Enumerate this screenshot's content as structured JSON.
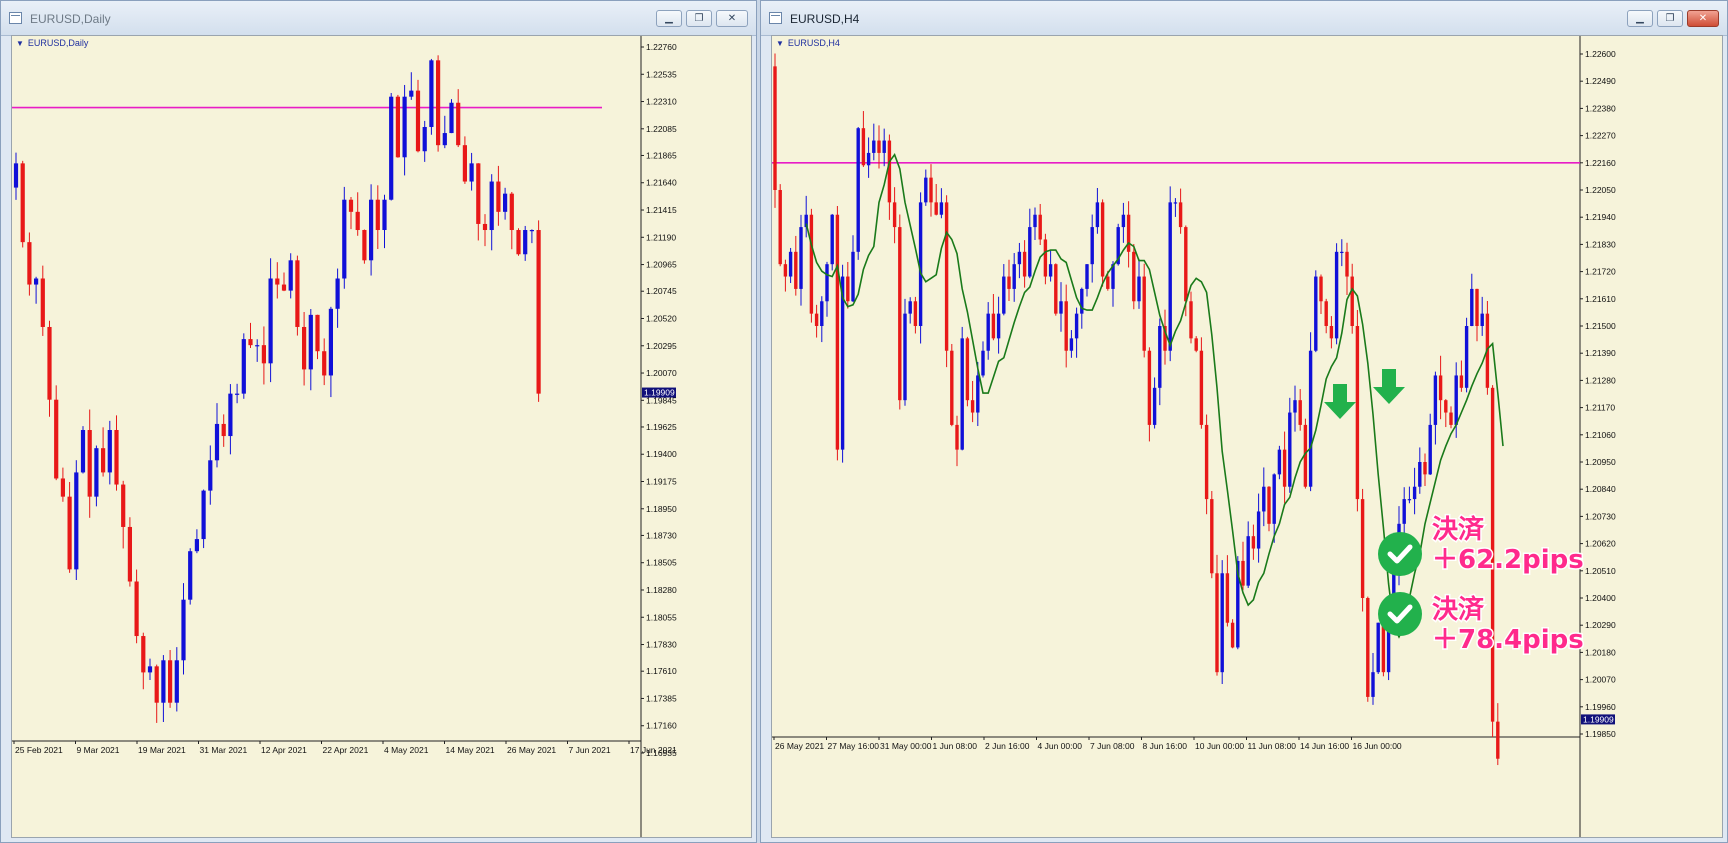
{
  "windows": [
    {
      "title": "EURUSD,Daily",
      "chart_label": "EURUSD,Daily",
      "price_ticks": [
        "1.22760",
        "1.22535",
        "1.22310",
        "1.22085",
        "1.21865",
        "1.21640",
        "1.21415",
        "1.21190",
        "1.20965",
        "1.20745",
        "1.20520",
        "1.20295",
        "1.20070",
        "1.19845",
        "1.19625",
        "1.19400",
        "1.19175",
        "1.18950",
        "1.18730",
        "1.18505",
        "1.18280",
        "1.18055",
        "1.17830",
        "1.17610",
        "1.17385",
        "1.17160",
        "1.16935"
      ],
      "current_price": "1.19909",
      "time_labels": [
        "25 Feb 2021",
        "9 Mar 2021",
        "19 Mar 2021",
        "31 Mar 2021",
        "12 Apr 2021",
        "22 Apr 2021",
        "4 May 2021",
        "14 May 2021",
        "26 May 2021",
        "7 Jun 2021",
        "17 Jun 2021"
      ],
      "horizontal_line_price": 1.2226,
      "line_color": "#e81cc6"
    },
    {
      "title": "EURUSD,H4",
      "chart_label": "EURUSD,H4",
      "price_ticks": [
        "1.22600",
        "1.22490",
        "1.22380",
        "1.22270",
        "1.22160",
        "1.22050",
        "1.21940",
        "1.21830",
        "1.21720",
        "1.21610",
        "1.21500",
        "1.21390",
        "1.21280",
        "1.21170",
        "1.21060",
        "1.20950",
        "1.20840",
        "1.20730",
        "1.20620",
        "1.20510",
        "1.20400",
        "1.20290",
        "1.20180",
        "1.20070",
        "1.19960",
        "1.19850"
      ],
      "current_price": "1.19909",
      "time_labels": [
        "26 May 2021",
        "27 May 16:00",
        "31 May 00:00",
        "1 Jun 08:00",
        "2 Jun 16:00",
        "4 Jun 00:00",
        "7 Jun 08:00",
        "8 Jun 16:00",
        "10 Jun 00:00",
        "11 Jun 08:00",
        "14 Jun 16:00",
        "16 Jun 00:00"
      ],
      "horizontal_line_price": 1.2216,
      "line_color": "#e81cc6",
      "moving_average_color": "#1a7a1a",
      "annotations": [
        {
          "heading": "決済",
          "profit": "＋62.2pips"
        },
        {
          "heading": "決済",
          "profit": "＋78.4pips"
        }
      ],
      "markers": [
        "down-arrow-icon",
        "down-arrow-icon",
        "check-icon",
        "check-icon"
      ]
    }
  ],
  "colors": {
    "bull": "#1010d8",
    "bear": "#e81818",
    "background": "#f6f3da",
    "label_color": "#ff2a8c",
    "check_color": "#22b14c"
  }
}
